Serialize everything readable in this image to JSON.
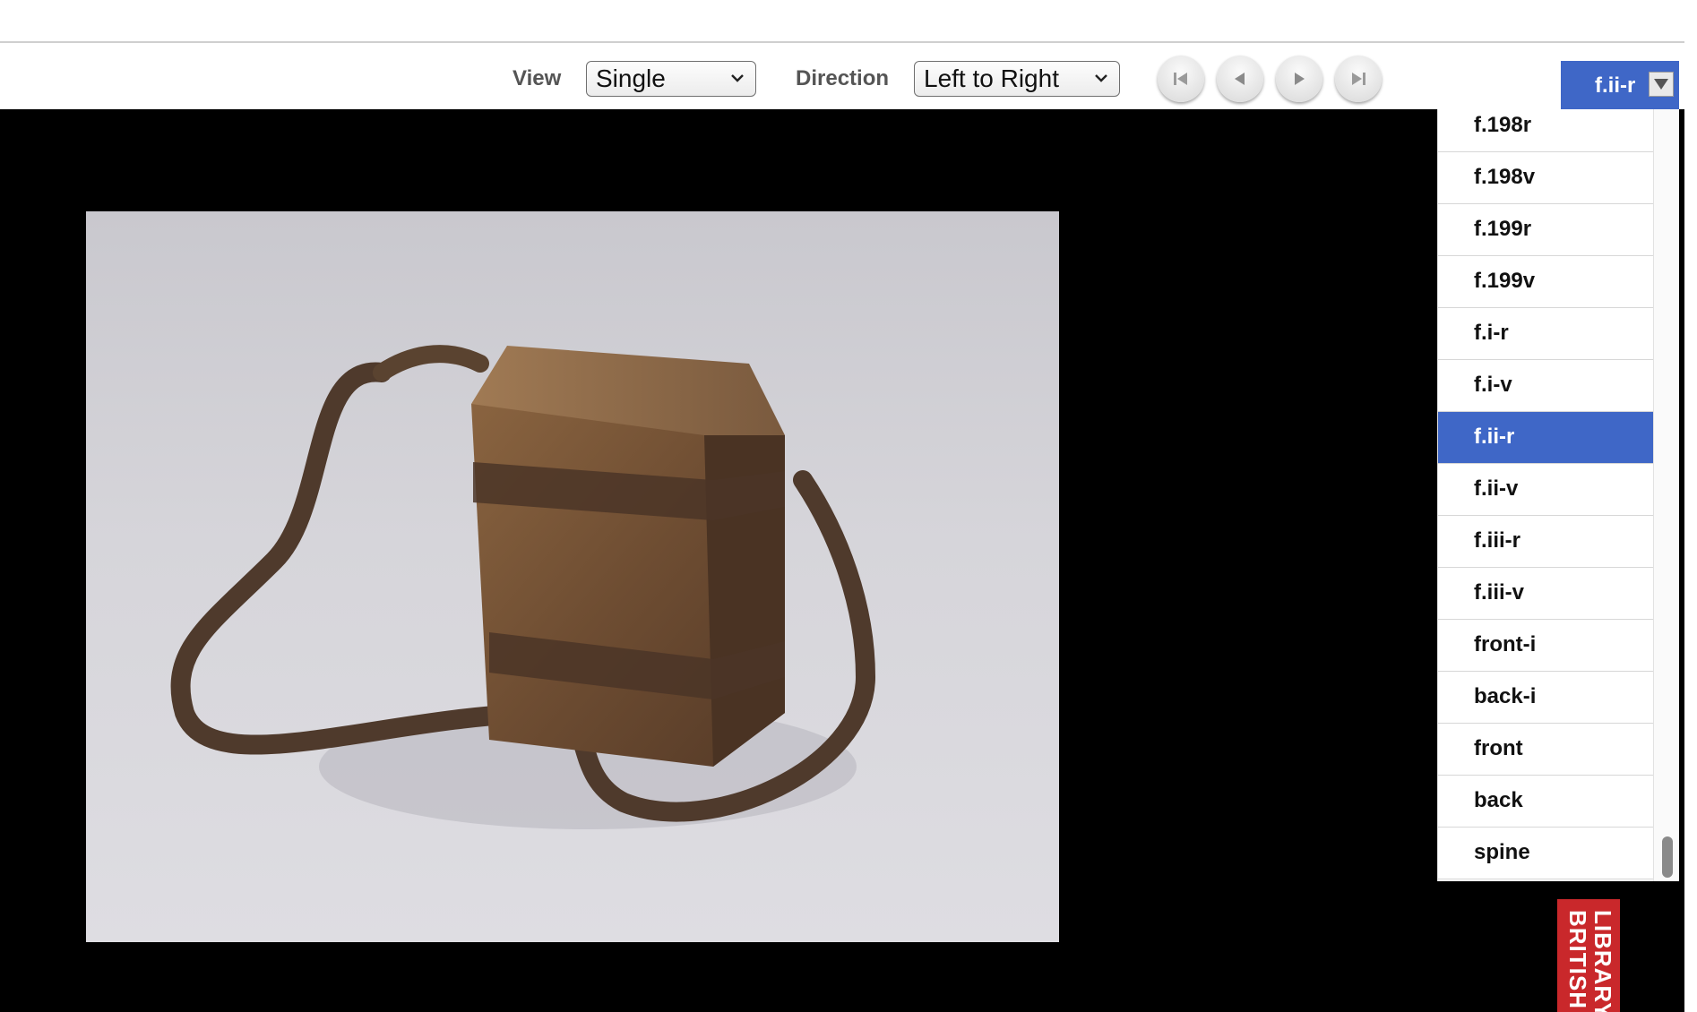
{
  "toolbar": {
    "view_label": "View",
    "view_value": "Single",
    "direction_label": "Direction",
    "direction_value": "Left to Right",
    "nav_buttons": [
      "first-page-icon",
      "previous-page-icon",
      "next-page-icon",
      "last-page-icon"
    ]
  },
  "page_select": {
    "value": "f.ii-r",
    "items": [
      "f.198r",
      "f.198v",
      "f.199r",
      "f.199v",
      "f.i-r",
      "f.i-v",
      "f.ii-r",
      "f.ii-v",
      "f.iii-r",
      "f.iii-v",
      "front-i",
      "back-i",
      "front",
      "back",
      "spine"
    ],
    "selected": "f.ii-r"
  },
  "logo": {
    "line1": "BRITISH",
    "line2": "LIBRARY"
  },
  "colors": {
    "accent": "#3f67c7",
    "viewer_background": "#000000",
    "logo_red": "#c9282b"
  }
}
